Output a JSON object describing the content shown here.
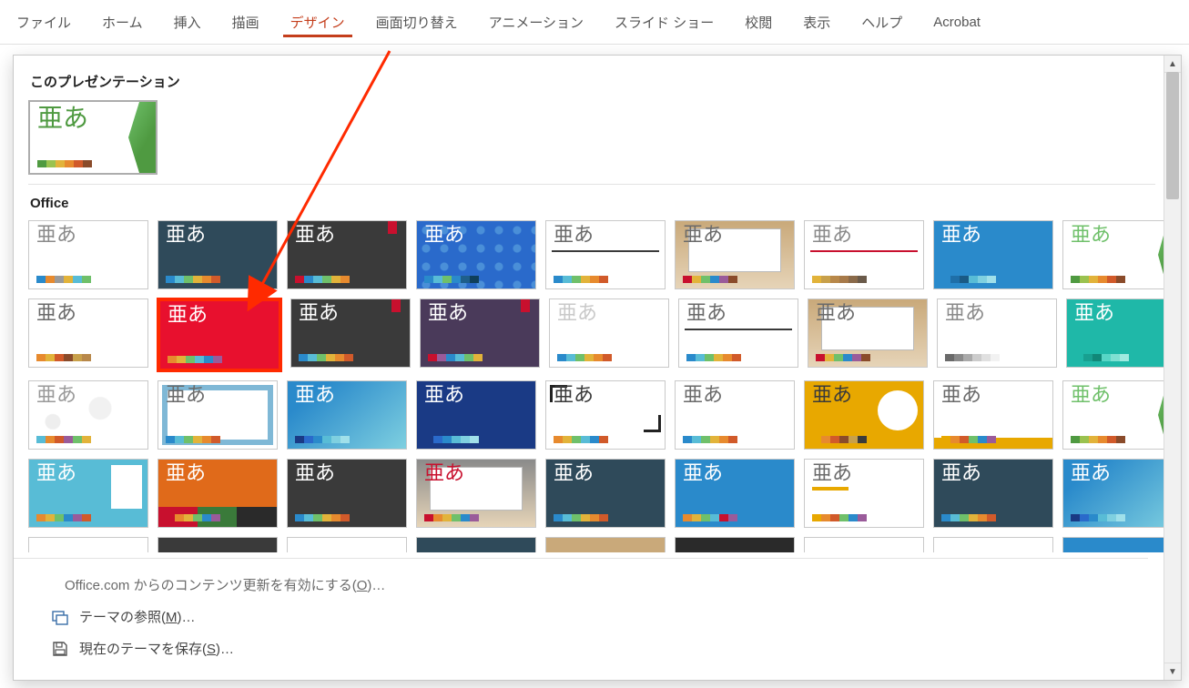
{
  "ribbon": {
    "tabs": [
      {
        "label": "ファイル",
        "active": false
      },
      {
        "label": "ホーム",
        "active": false
      },
      {
        "label": "挿入",
        "active": false
      },
      {
        "label": "描画",
        "active": false
      },
      {
        "label": "デザイン",
        "active": true
      },
      {
        "label": "画面切り替え",
        "active": false
      },
      {
        "label": "アニメーション",
        "active": false
      },
      {
        "label": "スライド ショー",
        "active": false
      },
      {
        "label": "校閲",
        "active": false
      },
      {
        "label": "表示",
        "active": false
      },
      {
        "label": "ヘルプ",
        "active": false
      },
      {
        "label": "Acrobat",
        "active": false
      }
    ]
  },
  "panel": {
    "section_this_presentation": "このプレゼンテーション",
    "section_office": "Office",
    "thumb_label": "亜あ",
    "current_theme_swatches": [
      "#4f9a41",
      "#9ac24f",
      "#e2b33a",
      "#e78a2e",
      "#d15a2a",
      "#8a4b2a"
    ],
    "generic_swatches_a": [
      "#2a8acb",
      "#58bcd6",
      "#6fc06a",
      "#e2b33a",
      "#e78a2e",
      "#d15a2a"
    ],
    "themes_row1": [
      {
        "bg": "#ffffff",
        "text": "#8a8a8a",
        "sw": [
          "#2a8acb",
          "#e78a2e",
          "#9a9a9a",
          "#e2b33a",
          "#58bcd6",
          "#6fc06a"
        ]
      },
      {
        "bg": "#2f4a5a",
        "text": "#ffffff",
        "sw": [
          "#2a8acb",
          "#58bcd6",
          "#6fc06a",
          "#e2b33a",
          "#e78a2e",
          "#d15a2a"
        ]
      },
      {
        "bg": "#3a3a3a",
        "text": "#ffffff",
        "accent": "#c8102e",
        "sw": [
          "#c8102e",
          "#2a8acb",
          "#58bcd6",
          "#6fc06a",
          "#e2b33a",
          "#e78a2e"
        ]
      },
      {
        "bg": "pattern-blue",
        "text": "#ffffff",
        "sw": [
          "#2a8acb",
          "#58bcd6",
          "#6fc06a",
          "#2a8acb",
          "#1f5f8b",
          "#0f3f5b"
        ]
      },
      {
        "bg": "#ffffff",
        "text": "#6a6a6a",
        "line": "#3a3a3a",
        "sw": [
          "#2a8acb",
          "#58bcd6",
          "#6fc06a",
          "#e2b33a",
          "#e78a2e",
          "#d15a2a"
        ]
      },
      {
        "bg": "#ffffff",
        "text": "#6a6a6a",
        "photo": "#c9a97a",
        "sw": [
          "#c8102e",
          "#e2b33a",
          "#6fc06a",
          "#2a8acb",
          "#9a5b9a",
          "#8a4b2a"
        ]
      },
      {
        "bg": "#ffffff",
        "text": "#8a8a8a",
        "line": "#c8102e",
        "sw": [
          "#e2b33a",
          "#c8a04a",
          "#b8884a",
          "#a77a4a",
          "#8a6a4a",
          "#6a5a4a"
        ]
      },
      {
        "bg": "#2a8acb",
        "text": "#ffffff",
        "sw": [
          "#2a8acb",
          "#1f6fa8",
          "#1a5a85",
          "#58bcd6",
          "#7fd0e0",
          "#a0e0ea"
        ]
      },
      {
        "bg": "#ffffff",
        "text": "#6fc06a",
        "facet": true,
        "sw": [
          "#4f9a41",
          "#9ac24f",
          "#e2b33a",
          "#e78a2e",
          "#d15a2a",
          "#8a4b2a"
        ]
      }
    ],
    "themes_row2": [
      {
        "bg": "#ffffff",
        "text": "#6a6a6a",
        "sw": [
          "#e78a2e",
          "#e2b33a",
          "#d15a2a",
          "#8a4b2a",
          "#c8a04a",
          "#b8884a"
        ]
      },
      {
        "bg": "#e8102e",
        "text": "#ffffff",
        "highlight": true,
        "sw": [
          "#e78a2e",
          "#e2b33a",
          "#6fc06a",
          "#58bcd6",
          "#2a8acb",
          "#9a5b9a"
        ]
      },
      {
        "bg": "#3a3a3a",
        "text": "#ffffff",
        "accent": "#c8102e",
        "sw": [
          "#2a8acb",
          "#58bcd6",
          "#6fc06a",
          "#e2b33a",
          "#e78a2e",
          "#d15a2a"
        ]
      },
      {
        "bg": "#4a3a5a",
        "text": "#ffffff",
        "accent": "#c8102e",
        "sw": [
          "#c8102e",
          "#9a5b9a",
          "#2a8acb",
          "#58bcd6",
          "#6fc06a",
          "#e2b33a"
        ]
      },
      {
        "bg": "#ffffff",
        "text": "#c9c9c9",
        "sw": [
          "#2a8acb",
          "#58bcd6",
          "#6fc06a",
          "#e2b33a",
          "#e78a2e",
          "#d15a2a"
        ]
      },
      {
        "bg": "#ffffff",
        "text": "#6a6a6a",
        "line": "#3a3a3a",
        "sw": [
          "#2a8acb",
          "#58bcd6",
          "#6fc06a",
          "#e2b33a",
          "#e78a2e",
          "#d15a2a"
        ]
      },
      {
        "bg": "#ffffff",
        "text": "#6a6a6a",
        "photo": "#c9a97a",
        "sw": [
          "#c8102e",
          "#e2b33a",
          "#6fc06a",
          "#2a8acb",
          "#9a5b9a",
          "#8a4b2a"
        ]
      },
      {
        "bg": "#ffffff",
        "text": "#8a8a8a",
        "sw": [
          "#6a6a6a",
          "#8a8a8a",
          "#aaaaaa",
          "#cccccc",
          "#e0e0e0",
          "#f2f2f2"
        ]
      },
      {
        "bg": "#1fb8a8",
        "text": "#ffffff",
        "sw": [
          "#1fb8a8",
          "#18a090",
          "#118878",
          "#58d6c6",
          "#7fe0d2",
          "#a0eae0"
        ]
      }
    ],
    "themes_row3": [
      {
        "bg": "#ffffff",
        "text": "#9a9a9a",
        "drops": true,
        "sw": [
          "#58bcd6",
          "#e78a2e",
          "#d15a2a",
          "#9a5b9a",
          "#6fc06a",
          "#e2b33a"
        ]
      },
      {
        "bg": "#ffffff",
        "text": "#6a6a6a",
        "border": "#7fb8d6",
        "sw": [
          "#2a8acb",
          "#58bcd6",
          "#6fc06a",
          "#e2b33a",
          "#e78a2e",
          "#d15a2a"
        ]
      },
      {
        "bg": "#2a8acb",
        "text": "#ffffff",
        "grad": true,
        "sw": [
          "#1a3a85",
          "#2a6acb",
          "#2a8acb",
          "#58bcd6",
          "#7fd0e0",
          "#a0e0ea"
        ]
      },
      {
        "bg": "#1a3a85",
        "text": "#ffffff",
        "sw": [
          "#1a3a85",
          "#2a6acb",
          "#2a8acb",
          "#58bcd6",
          "#7fd0e0",
          "#a0e0ea"
        ]
      },
      {
        "bg": "#ffffff",
        "text": "#3a3a3a",
        "corners": true,
        "sw": [
          "#e78a2e",
          "#e2b33a",
          "#6fc06a",
          "#58bcd6",
          "#2a8acb",
          "#d15a2a"
        ]
      },
      {
        "bg": "#ffffff",
        "text": "#6a6a6a",
        "sw": [
          "#2a8acb",
          "#58bcd6",
          "#6fc06a",
          "#e2b33a",
          "#e78a2e",
          "#d15a2a"
        ]
      },
      {
        "bg": "#e8a800",
        "text": "#3a3a3a",
        "circle": true,
        "sw": [
          "#e8a800",
          "#e78a2e",
          "#d15a2a",
          "#8a4b2a",
          "#c8a04a",
          "#3a3a3a"
        ]
      },
      {
        "bg": "#ffffff",
        "text": "#6a6a6a",
        "band": "#e8a800",
        "sw": [
          "#e8a800",
          "#e78a2e",
          "#d15a2a",
          "#6fc06a",
          "#2a8acb",
          "#9a5b9a"
        ]
      },
      {
        "bg": "#ffffff",
        "text": "#6fc06a",
        "facet": true,
        "sw": [
          "#4f9a41",
          "#9ac24f",
          "#e2b33a",
          "#e78a2e",
          "#d15a2a",
          "#8a4b2a"
        ]
      }
    ],
    "themes_row4": [
      {
        "bg": "#58bcd6",
        "text": "#ffffff",
        "wbox": true,
        "sw": [
          "#e78a2e",
          "#e2b33a",
          "#6fc06a",
          "#2a8acb",
          "#9a5b9a",
          "#d15a2a"
        ]
      },
      {
        "bg": "#e06a1a",
        "text": "#ffffff",
        "blocks": true,
        "sw": [
          "#c8102e",
          "#e78a2e",
          "#e2b33a",
          "#6fc06a",
          "#2a8acb",
          "#9a5b9a"
        ]
      },
      {
        "bg": "#3a3a3a",
        "text": "#ffffff",
        "sw": [
          "#2a8acb",
          "#58bcd6",
          "#6fc06a",
          "#e2b33a",
          "#e78a2e",
          "#d15a2a"
        ]
      },
      {
        "bg": "#ffffff",
        "text": "#c8102e",
        "photo": "#8a8a8a",
        "sw": [
          "#c8102e",
          "#e78a2e",
          "#e2b33a",
          "#6fc06a",
          "#2a8acb",
          "#9a5b9a"
        ]
      },
      {
        "bg": "#2f4a5a",
        "text": "#ffffff",
        "sw": [
          "#2a8acb",
          "#58bcd6",
          "#6fc06a",
          "#e2b33a",
          "#e78a2e",
          "#d15a2a"
        ]
      },
      {
        "bg": "#2a8acb",
        "text": "#ffffff",
        "sw": [
          "#e78a2e",
          "#e2b33a",
          "#6fc06a",
          "#58bcd6",
          "#c8102e",
          "#9a5b9a"
        ]
      },
      {
        "bg": "#ffffff",
        "text": "#6a6a6a",
        "ubar": "#e8a800",
        "sw": [
          "#e8a800",
          "#e78a2e",
          "#d15a2a",
          "#6fc06a",
          "#2a8acb",
          "#9a5b9a"
        ]
      },
      {
        "bg": "#2f4a5a",
        "text": "#ffffff",
        "sw": [
          "#2a8acb",
          "#58bcd6",
          "#6fc06a",
          "#e2b33a",
          "#e78a2e",
          "#d15a2a"
        ]
      },
      {
        "bg": "#2a8acb",
        "text": "#ffffff",
        "grad": true,
        "sw": [
          "#1a3a85",
          "#2a6acb",
          "#2a8acb",
          "#58bcd6",
          "#7fd0e0",
          "#a0e0ea"
        ]
      }
    ]
  },
  "footer": {
    "content_update_prefix": "Office.com からのコンテンツ更新を有効にする(",
    "content_update_mnemonic": "O",
    "content_update_suffix": ")…",
    "browse_prefix": "テーマの参照(",
    "browse_mnemonic": "M",
    "browse_suffix": ")…",
    "save_prefix": "現在のテーマを保存(",
    "save_mnemonic": "S",
    "save_suffix": ")…"
  }
}
